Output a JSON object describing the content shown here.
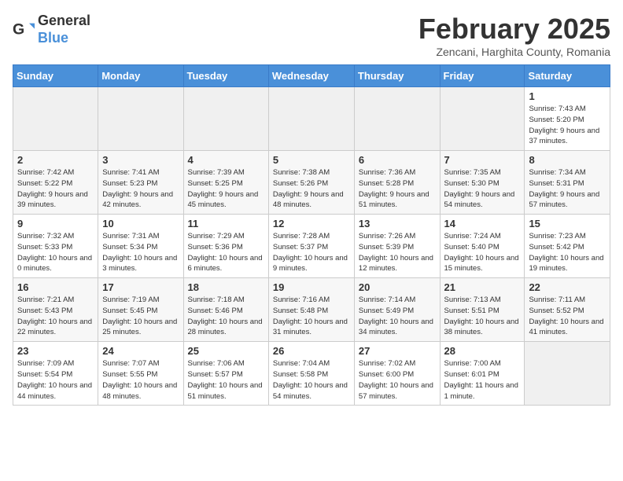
{
  "header": {
    "logo_general": "General",
    "logo_blue": "Blue",
    "month_title": "February 2025",
    "subtitle": "Zencani, Harghita County, Romania"
  },
  "days_of_week": [
    "Sunday",
    "Monday",
    "Tuesday",
    "Wednesday",
    "Thursday",
    "Friday",
    "Saturday"
  ],
  "weeks": [
    [
      {
        "day": "",
        "info": ""
      },
      {
        "day": "",
        "info": ""
      },
      {
        "day": "",
        "info": ""
      },
      {
        "day": "",
        "info": ""
      },
      {
        "day": "",
        "info": ""
      },
      {
        "day": "",
        "info": ""
      },
      {
        "day": "1",
        "info": "Sunrise: 7:43 AM\nSunset: 5:20 PM\nDaylight: 9 hours and 37 minutes."
      }
    ],
    [
      {
        "day": "2",
        "info": "Sunrise: 7:42 AM\nSunset: 5:22 PM\nDaylight: 9 hours and 39 minutes."
      },
      {
        "day": "3",
        "info": "Sunrise: 7:41 AM\nSunset: 5:23 PM\nDaylight: 9 hours and 42 minutes."
      },
      {
        "day": "4",
        "info": "Sunrise: 7:39 AM\nSunset: 5:25 PM\nDaylight: 9 hours and 45 minutes."
      },
      {
        "day": "5",
        "info": "Sunrise: 7:38 AM\nSunset: 5:26 PM\nDaylight: 9 hours and 48 minutes."
      },
      {
        "day": "6",
        "info": "Sunrise: 7:36 AM\nSunset: 5:28 PM\nDaylight: 9 hours and 51 minutes."
      },
      {
        "day": "7",
        "info": "Sunrise: 7:35 AM\nSunset: 5:30 PM\nDaylight: 9 hours and 54 minutes."
      },
      {
        "day": "8",
        "info": "Sunrise: 7:34 AM\nSunset: 5:31 PM\nDaylight: 9 hours and 57 minutes."
      }
    ],
    [
      {
        "day": "9",
        "info": "Sunrise: 7:32 AM\nSunset: 5:33 PM\nDaylight: 10 hours and 0 minutes."
      },
      {
        "day": "10",
        "info": "Sunrise: 7:31 AM\nSunset: 5:34 PM\nDaylight: 10 hours and 3 minutes."
      },
      {
        "day": "11",
        "info": "Sunrise: 7:29 AM\nSunset: 5:36 PM\nDaylight: 10 hours and 6 minutes."
      },
      {
        "day": "12",
        "info": "Sunrise: 7:28 AM\nSunset: 5:37 PM\nDaylight: 10 hours and 9 minutes."
      },
      {
        "day": "13",
        "info": "Sunrise: 7:26 AM\nSunset: 5:39 PM\nDaylight: 10 hours and 12 minutes."
      },
      {
        "day": "14",
        "info": "Sunrise: 7:24 AM\nSunset: 5:40 PM\nDaylight: 10 hours and 15 minutes."
      },
      {
        "day": "15",
        "info": "Sunrise: 7:23 AM\nSunset: 5:42 PM\nDaylight: 10 hours and 19 minutes."
      }
    ],
    [
      {
        "day": "16",
        "info": "Sunrise: 7:21 AM\nSunset: 5:43 PM\nDaylight: 10 hours and 22 minutes."
      },
      {
        "day": "17",
        "info": "Sunrise: 7:19 AM\nSunset: 5:45 PM\nDaylight: 10 hours and 25 minutes."
      },
      {
        "day": "18",
        "info": "Sunrise: 7:18 AM\nSunset: 5:46 PM\nDaylight: 10 hours and 28 minutes."
      },
      {
        "day": "19",
        "info": "Sunrise: 7:16 AM\nSunset: 5:48 PM\nDaylight: 10 hours and 31 minutes."
      },
      {
        "day": "20",
        "info": "Sunrise: 7:14 AM\nSunset: 5:49 PM\nDaylight: 10 hours and 34 minutes."
      },
      {
        "day": "21",
        "info": "Sunrise: 7:13 AM\nSunset: 5:51 PM\nDaylight: 10 hours and 38 minutes."
      },
      {
        "day": "22",
        "info": "Sunrise: 7:11 AM\nSunset: 5:52 PM\nDaylight: 10 hours and 41 minutes."
      }
    ],
    [
      {
        "day": "23",
        "info": "Sunrise: 7:09 AM\nSunset: 5:54 PM\nDaylight: 10 hours and 44 minutes."
      },
      {
        "day": "24",
        "info": "Sunrise: 7:07 AM\nSunset: 5:55 PM\nDaylight: 10 hours and 48 minutes."
      },
      {
        "day": "25",
        "info": "Sunrise: 7:06 AM\nSunset: 5:57 PM\nDaylight: 10 hours and 51 minutes."
      },
      {
        "day": "26",
        "info": "Sunrise: 7:04 AM\nSunset: 5:58 PM\nDaylight: 10 hours and 54 minutes."
      },
      {
        "day": "27",
        "info": "Sunrise: 7:02 AM\nSunset: 6:00 PM\nDaylight: 10 hours and 57 minutes."
      },
      {
        "day": "28",
        "info": "Sunrise: 7:00 AM\nSunset: 6:01 PM\nDaylight: 11 hours and 1 minute."
      },
      {
        "day": "",
        "info": ""
      }
    ]
  ]
}
